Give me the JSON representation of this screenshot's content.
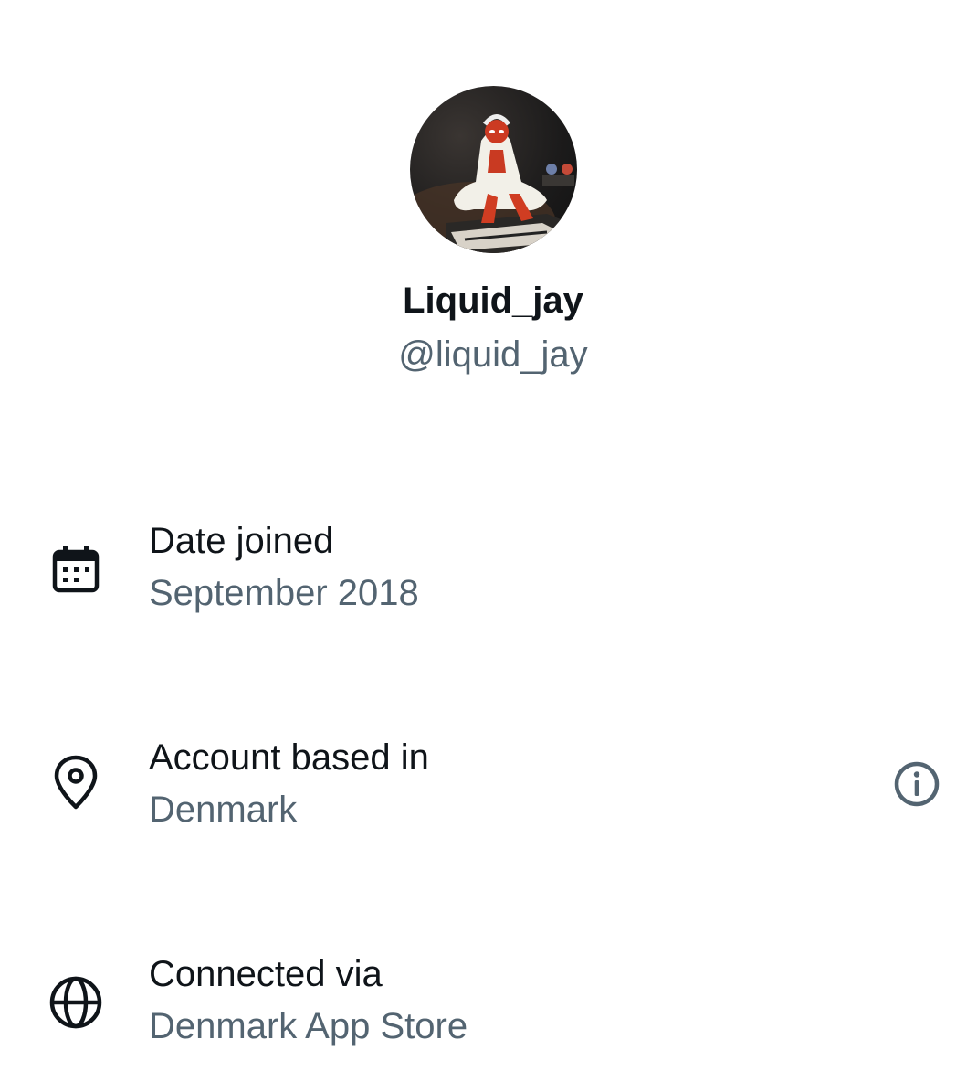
{
  "profile": {
    "display_name": "Liquid_jay",
    "handle": "@liquid_jay",
    "avatar_icon": "profile-avatar"
  },
  "rows": [
    {
      "icon": "calendar-icon",
      "label": "Date joined",
      "value": "September 2018"
    },
    {
      "icon": "location-pin-icon",
      "label": "Account based in",
      "value": "Denmark",
      "trailing_icon": "info-icon"
    },
    {
      "icon": "globe-icon",
      "label": "Connected via",
      "value": "Denmark App Store"
    }
  ],
  "colors": {
    "primary_text": "#0f1419",
    "secondary_text": "#536471",
    "background": "#ffffff"
  }
}
